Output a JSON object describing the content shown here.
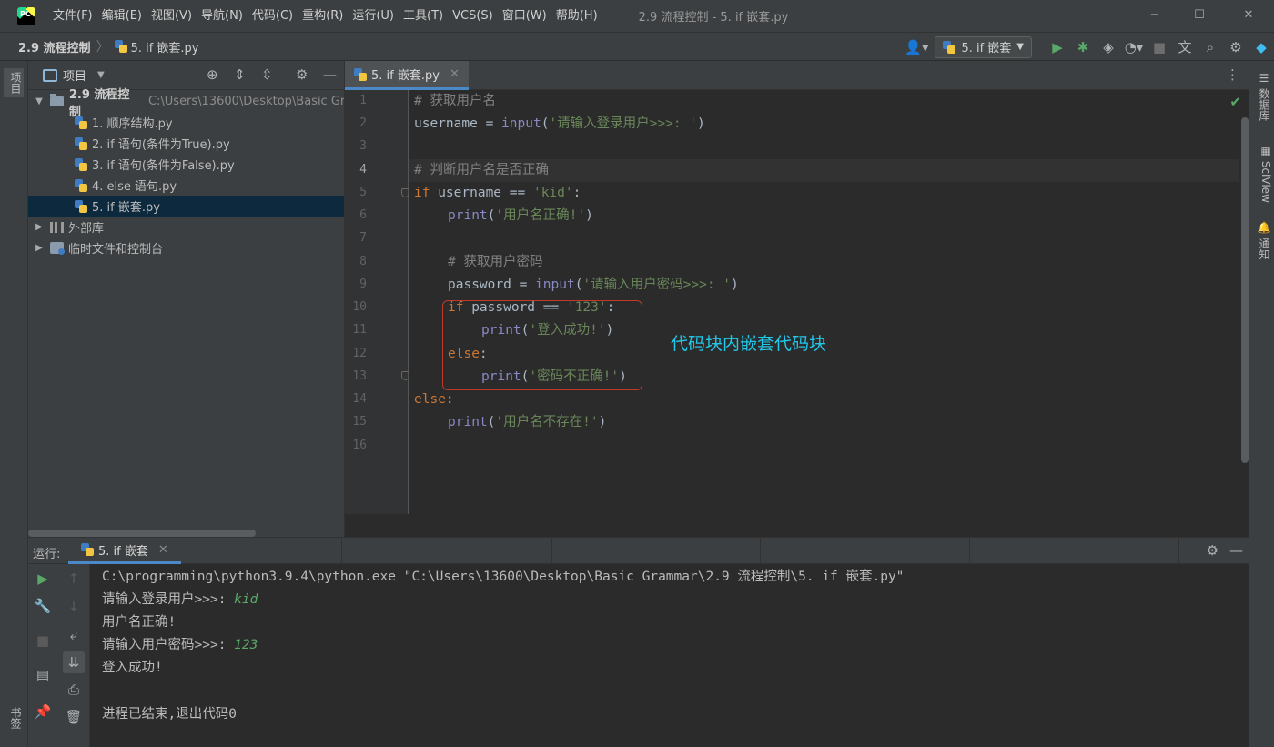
{
  "menubar": {
    "logo_text": "PC",
    "items": [
      "文件(F)",
      "编辑(E)",
      "视图(V)",
      "导航(N)",
      "代码(C)",
      "重构(R)",
      "运行(U)",
      "工具(T)",
      "VCS(S)",
      "窗口(W)",
      "帮助(H)"
    ],
    "window_title": "2.9 流程控制 - 5. if 嵌套.py",
    "controls": {
      "minimize": "−",
      "maximize": "☐",
      "close": "✕"
    }
  },
  "navbar": {
    "project": "2.9 流程控制",
    "file": "5. if 嵌套.py",
    "run_config": "5. if 嵌套",
    "icons": [
      "user-icon",
      "run-icon",
      "debug-icon",
      "coverage-icon",
      "profile-icon",
      "stop-icon",
      "translate-icon",
      "search-icon",
      "settings-icon",
      "jetbrains-icon"
    ]
  },
  "left_strip": {
    "project_tab": "项目",
    "bookmarks_tab": "书签"
  },
  "right_strip": {
    "database_tab": "数据库",
    "sciview_tab": "SciView",
    "notifications_tab": "通知"
  },
  "project_panel": {
    "title": "项目",
    "root": {
      "name": "2.9 流程控制",
      "path": "C:\\Users\\13600\\Desktop\\Basic Gr"
    },
    "files": [
      {
        "name": "1. 顺序结构.py",
        "selected": false
      },
      {
        "name": "2. if 语句(条件为True).py",
        "selected": false
      },
      {
        "name": "3. if 语句(条件为False).py",
        "selected": false
      },
      {
        "name": "4. else 语句.py",
        "selected": false
      },
      {
        "name": "5. if 嵌套.py",
        "selected": true
      }
    ],
    "external_libs": "外部库",
    "scratches": "临时文件和控制台"
  },
  "editor": {
    "tab": "5. if 嵌套.py",
    "current_line": 4,
    "line_numbers": [
      "1",
      "2",
      "3",
      "4",
      "5",
      "6",
      "7",
      "8",
      "9",
      "10",
      "11",
      "12",
      "13",
      "14",
      "15",
      "16"
    ],
    "code": {
      "l1": "# 获取用户名",
      "l2_var": "username = ",
      "l2_fn": "input",
      "l2_p1": "(",
      "l2_str": "'请输入登录用户>>>: '",
      "l2_p2": ")",
      "l4": "# 判断用户名是否正确",
      "l5_kw": "if",
      "l5_mid": " username == ",
      "l5_str": "'kid'",
      "l5_end": ":",
      "l6_fn": "print",
      "l6_str": "'用户名正确!'",
      "l8": "# 获取用户密码",
      "l9_var": "password = ",
      "l9_fn": "input",
      "l9_str": "'请输入用户密码>>>: '",
      "l10_kw": "if",
      "l10_mid": " password == ",
      "l10_str": "'123'",
      "l11_fn": "print",
      "l11_str": "'登入成功!'",
      "l12_kw": "else",
      "l13_fn": "print",
      "l13_str": "'密码不正确!'",
      "l14_kw": "else",
      "l15_fn": "print",
      "l15_str": "'用户名不存在!'"
    },
    "annotation": "代码块内嵌套代码块"
  },
  "run_panel": {
    "label": "运行:",
    "tab": "5. if 嵌套",
    "console": {
      "cmd": "C:\\programming\\python3.9.4\\python.exe \"C:\\Users\\13600\\Desktop\\Basic Grammar\\2.9 流程控制\\5. if 嵌套.py\"",
      "prompt_user": "请输入登录用户>>>: ",
      "input_user": "kid",
      "user_ok": "用户名正确!",
      "prompt_pwd": "请输入用户密码>>>: ",
      "input_pwd": "123",
      "login_ok": "登入成功!",
      "exit_msg": "进程已结束,退出代码0"
    }
  },
  "colors": {
    "keyword": "#cc7832",
    "string": "#6a8759",
    "builtin": "#8888c6",
    "comment": "#808080",
    "annotation": "#22c7ea",
    "highlight_box": "#c0392b"
  }
}
